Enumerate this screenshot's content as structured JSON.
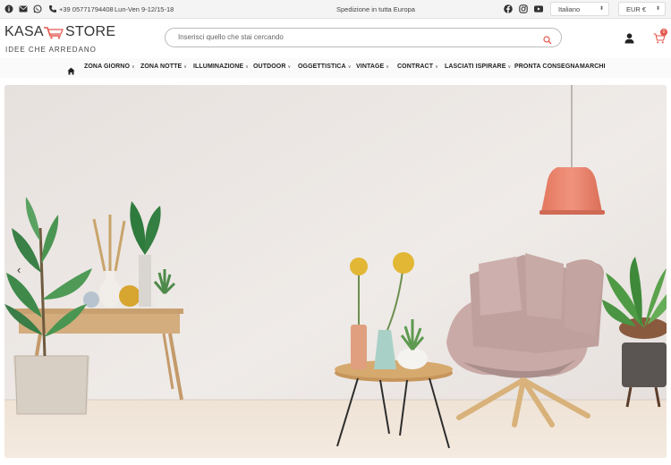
{
  "topbar": {
    "phone": "+39 05771794408",
    "hours": "Lun-Ven 9-12/15-18",
    "shipping": "Spedizione in tutta Europa",
    "language": "Italiano",
    "currency": "EUR €"
  },
  "header": {
    "logo_left": "KASA",
    "logo_right": "STORE",
    "logo_tagline": "IDEE CHE ARREDANO",
    "search_placeholder": "Inserisci quello che stai cercando",
    "cart_count": "0"
  },
  "nav": {
    "items": [
      {
        "label": "ZONA GIORNO",
        "chevron": true
      },
      {
        "label": "ZONA NOTTE",
        "chevron": true
      },
      {
        "label": "ILLUMINAZIONE",
        "chevron": true
      },
      {
        "label": "OUTDOOR",
        "chevron": true
      },
      {
        "label": "OGGETTISTICA",
        "chevron": true
      },
      {
        "label": "VINTAGE",
        "chevron": true
      },
      {
        "label": "CONTRACT",
        "chevron": true
      },
      {
        "label": "LASCIATI ISPIRARE",
        "chevron": true
      },
      {
        "label": "PRONTA CONSEGNA",
        "chevron": false
      },
      {
        "label": "MARCHI",
        "chevron": false
      }
    ]
  },
  "hero": {
    "icon": "chevron-left-icon"
  },
  "colors": {
    "topbar_bg": "#f4f4f4",
    "hero_wall": "#ebe6e3",
    "lamp": "#e9826e",
    "cart_badge": "#e4574d"
  }
}
